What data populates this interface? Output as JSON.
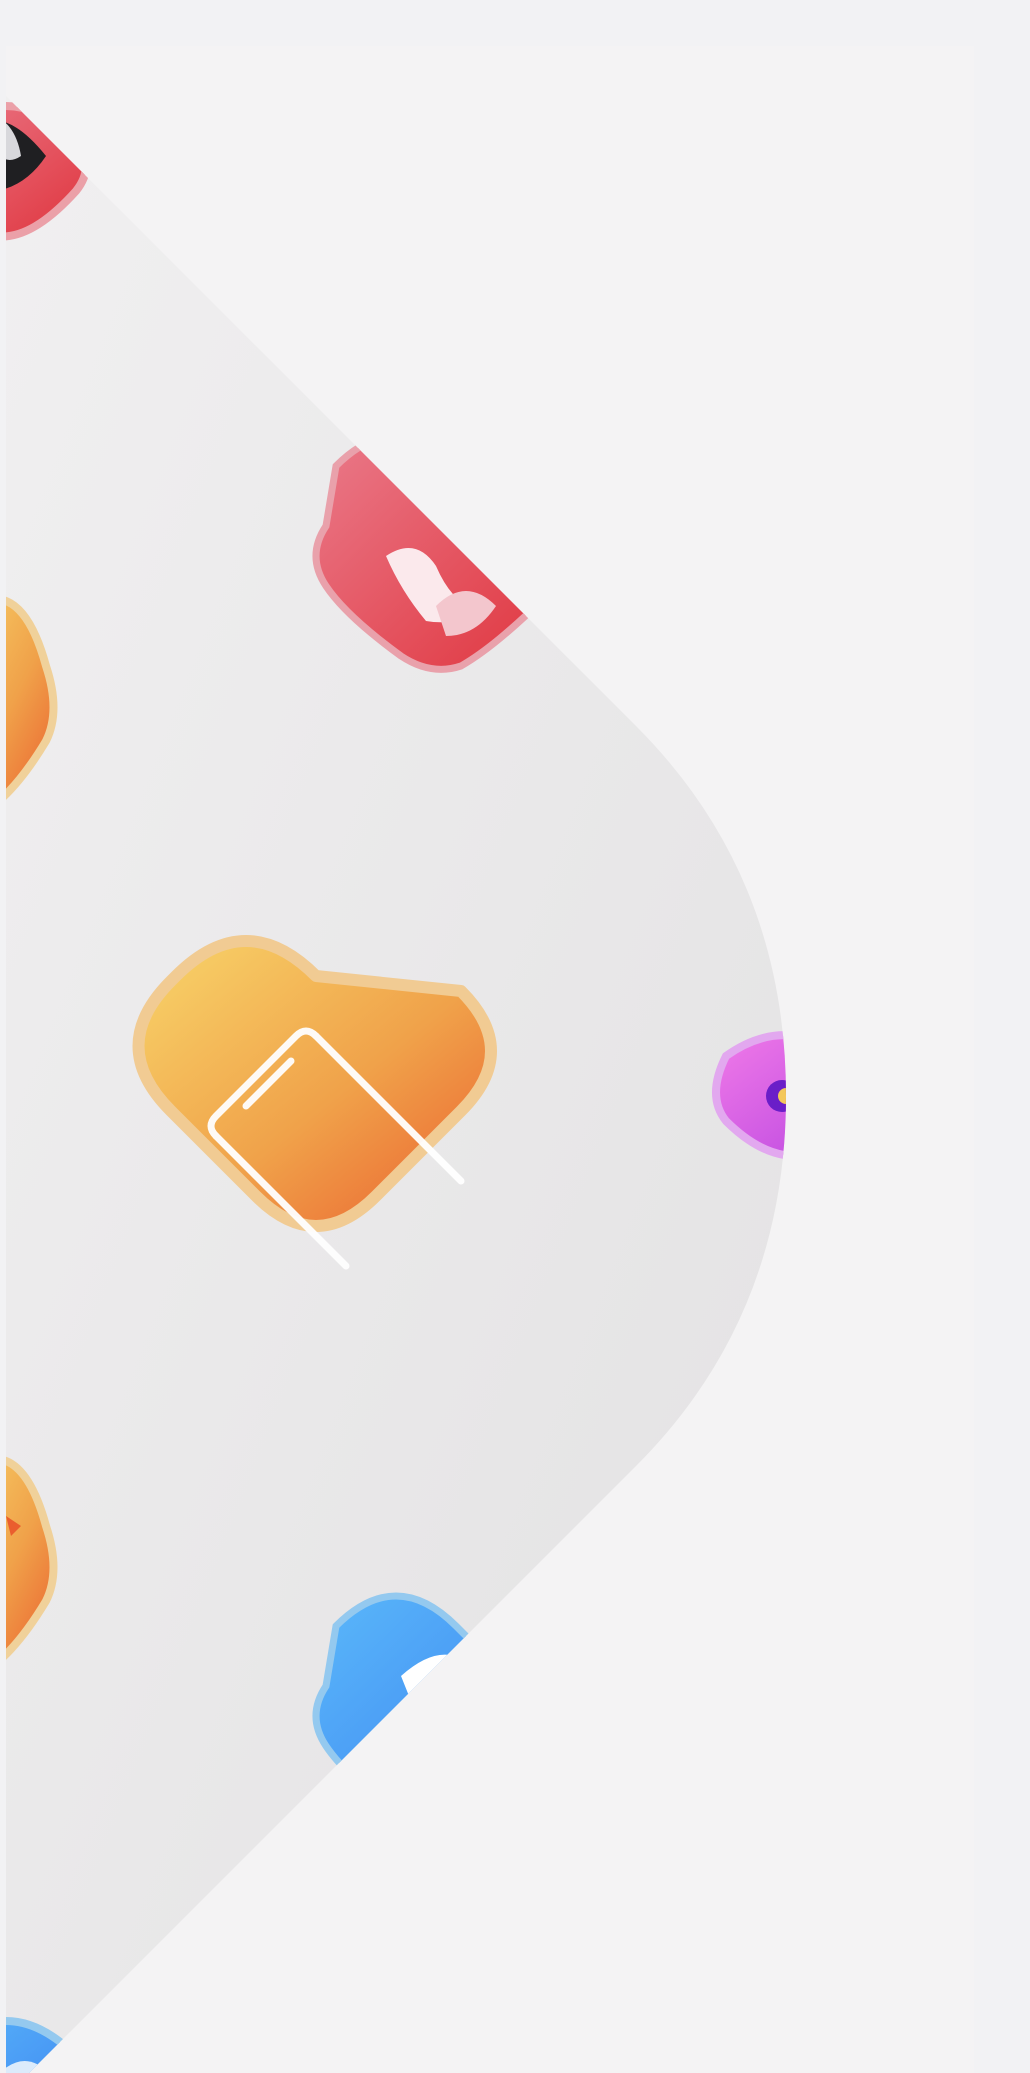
{
  "hero": {
    "icons": [
      {
        "name": "video-icon",
        "visible": "partial"
      },
      {
        "name": "anime-icon",
        "visible": "partial"
      },
      {
        "name": "books-icon",
        "visible": "partial"
      },
      {
        "name": "phone-icon",
        "visible": "full"
      },
      {
        "name": "camera-icon",
        "visible": "partial"
      },
      {
        "name": "hourglass-icon",
        "visible": "partial"
      },
      {
        "name": "reader-icon",
        "visible": "partial"
      },
      {
        "name": "chat-icon",
        "visible": "partial"
      }
    ],
    "colors": {
      "page_background": "#f2f2f4",
      "panel_background": "#f4f3f4",
      "shape_light": "#f1f0f1",
      "shape_dark": "#e4e3e4",
      "red_icon": "#e0424e",
      "orange_icon": "#f09a3e",
      "blue_icon": "#3f8ff2",
      "purple_icon": "#c04be3"
    }
  }
}
